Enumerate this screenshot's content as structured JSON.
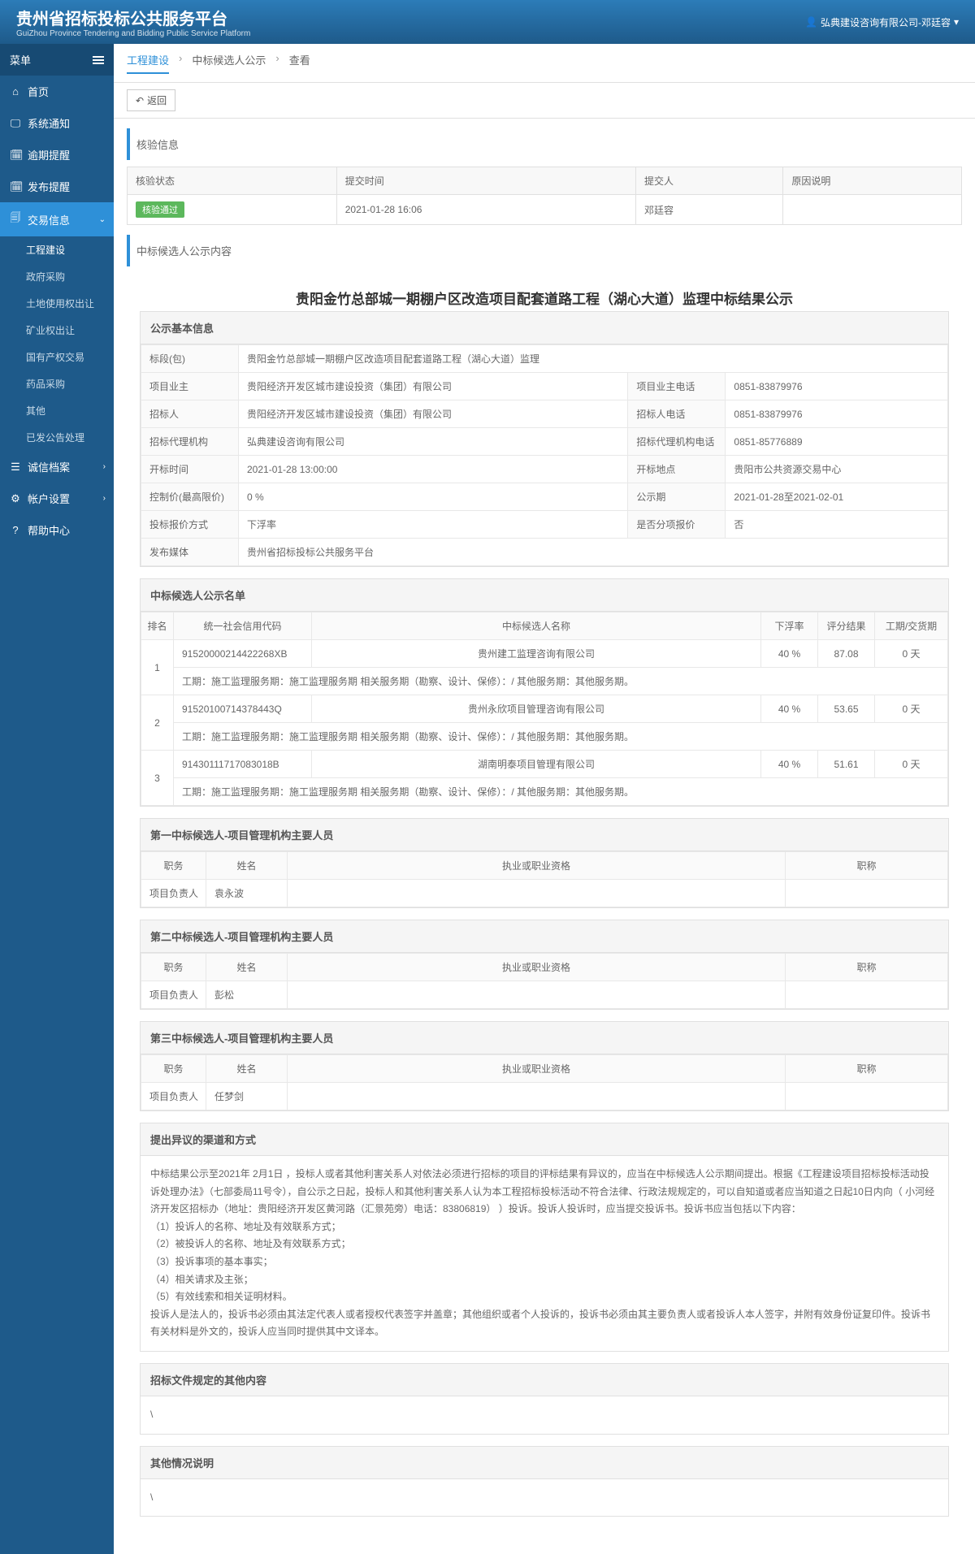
{
  "header": {
    "title_cn": "贵州省招标投标公共服务平台",
    "title_en": "GuiZhou Province Tendering and Bidding Public Service Platform",
    "user": "弘典建设咨询有限公司-邓廷容"
  },
  "sidebar": {
    "menu_label": "菜单",
    "items": [
      {
        "label": "首页",
        "icon": "⌂"
      },
      {
        "label": "系统通知",
        "icon": "🖵"
      },
      {
        "label": "逾期提醒",
        "icon": "🗓"
      },
      {
        "label": "发布提醒",
        "icon": "🗓"
      },
      {
        "label": "交易信息",
        "icon": "🗐",
        "active": true,
        "expand": true
      },
      {
        "label": "诚信档案",
        "icon": "☰",
        "expand": true
      },
      {
        "label": "帐户设置",
        "icon": "⚙",
        "expand": true
      },
      {
        "label": "帮助中心",
        "icon": "?"
      }
    ],
    "sub": [
      {
        "label": "工程建设",
        "active": true
      },
      {
        "label": "政府采购"
      },
      {
        "label": "土地使用权出让"
      },
      {
        "label": "矿业权出让"
      },
      {
        "label": "国有产权交易"
      },
      {
        "label": "药品采购"
      },
      {
        "label": "其他"
      },
      {
        "label": "已发公告处理"
      }
    ]
  },
  "breadcrumb": [
    "工程建设",
    "中标候选人公示",
    "查看"
  ],
  "toolbar": {
    "back_label": "返回"
  },
  "sections": {
    "verify": "核验信息",
    "announce": "中标候选人公示内容"
  },
  "verify": {
    "cols": [
      "核验状态",
      "提交时间",
      "提交人",
      "原因说明"
    ],
    "status": "核验通过",
    "time": "2021-01-28 16:06",
    "person": "邓廷容",
    "reason": ""
  },
  "page_title": "贵阳金竹总部城一期棚户区改造项目配套道路工程（湖心大道）监理中标结果公示",
  "basic": {
    "title": "公示基本信息",
    "rows": {
      "biaoduan_lbl": "标段(包)",
      "biaoduan": "贵阳金竹总部城一期棚户区改造项目配套道路工程（湖心大道）监理",
      "yezhu_lbl": "项目业主",
      "yezhu": "贵阳经济开发区城市建设投资（集团）有限公司",
      "yezhu_tel_lbl": "项目业主电话",
      "yezhu_tel": "0851-83879976",
      "zbr_lbl": "招标人",
      "zbr": "贵阳经济开发区城市建设投资（集团）有限公司",
      "zbr_tel_lbl": "招标人电话",
      "zbr_tel": "0851-83879976",
      "dljg_lbl": "招标代理机构",
      "dljg": "弘典建设咨询有限公司",
      "dljg_tel_lbl": "招标代理机构电话",
      "dljg_tel": "0851-85776889",
      "kaibiao_lbl": "开标时间",
      "kaibiao": "2021-01-28 13:00:00",
      "kbdd_lbl": "开标地点",
      "kbdd": "贵阳市公共资源交易中心",
      "kzj_lbl": "控制价(最高限价)",
      "kzj": "0 %",
      "gsq_lbl": "公示期",
      "gsq": "2021-01-28至2021-02-01",
      "tbfs_lbl": "投标报价方式",
      "tbfs": "下浮率",
      "fxbj_lbl": "是否分项报价",
      "fxbj": "否",
      "fbmt_lbl": "发布媒体",
      "fbmt": "贵州省招标投标公共服务平台"
    }
  },
  "candidates": {
    "title": "中标候选人公示名单",
    "cols": [
      "排名",
      "统一社会信用代码",
      "中标候选人名称",
      "下浮率",
      "评分结果",
      "工期/交货期"
    ],
    "detail_prefix": "工期：施工监理服务期：施工监理服务期 相关服务期（勘察、设计、保修）：/ 其他服务期：其他服务期。",
    "rows": [
      {
        "rank": "1",
        "code": "91520000214422268XB",
        "name": "贵州建工监理咨询有限公司",
        "rate": "40 %",
        "score": "87.08",
        "period": "0 天"
      },
      {
        "rank": "2",
        "code": "91520100714378443Q",
        "name": "贵州永欣项目管理咨询有限公司",
        "rate": "40 %",
        "score": "53.65",
        "period": "0 天"
      },
      {
        "rank": "3",
        "code": "91430111717083018B",
        "name": "湖南明泰项目管理有限公司",
        "rate": "40 %",
        "score": "51.61",
        "period": "0 天"
      }
    ]
  },
  "personnel": {
    "cols": [
      "职务",
      "姓名",
      "执业或职业资格",
      "职称"
    ],
    "p1": {
      "title": "第一中标候选人-项目管理机构主要人员",
      "role": "项目负责人",
      "name": "袁永波"
    },
    "p2": {
      "title": "第二中标候选人-项目管理机构主要人员",
      "role": "项目负责人",
      "name": "彭松"
    },
    "p3": {
      "title": "第三中标候选人-项目管理机构主要人员",
      "role": "项目负责人",
      "name": "任梦剑"
    }
  },
  "objection": {
    "title": "提出异议的渠道和方式",
    "text": "中标结果公示至2021年 2月1日 ，投标人或者其他利害关系人对依法必须进行招标的项目的评标结果有异议的，应当在中标候选人公示期间提出。根据《工程建设项目招标投标活动投诉处理办法》（七部委局11号令），自公示之日起，投标人和其他利害关系人认为本工程招标投标活动不符合法律、行政法规规定的，可以自知道或者应当知道之日起10日内向（ 小河经济开发区招标办（地址：贵阳经济开发区黄河路（汇景苑旁）电话：83806819） ）投诉。投诉人投诉时，应当提交投诉书。投诉书应当包括以下内容：\n（1）投诉人的名称、地址及有效联系方式；\n（2）被投诉人的名称、地址及有效联系方式；\n（3）投诉事项的基本事实；\n（4）相关请求及主张；\n（5）有效线索和相关证明材料。\n投诉人是法人的，投诉书必须由其法定代表人或者授权代表签字并盖章；其他组织或者个人投诉的，投诉书必须由其主要负责人或者投诉人本人签字，并附有效身份证复印件。投诉书有关材料是外文的，投诉人应当同时提供其中文译本。"
  },
  "other1": {
    "title": "招标文件规定的其他内容",
    "text": "\\"
  },
  "other2": {
    "title": "其他情况说明",
    "text": "\\"
  }
}
